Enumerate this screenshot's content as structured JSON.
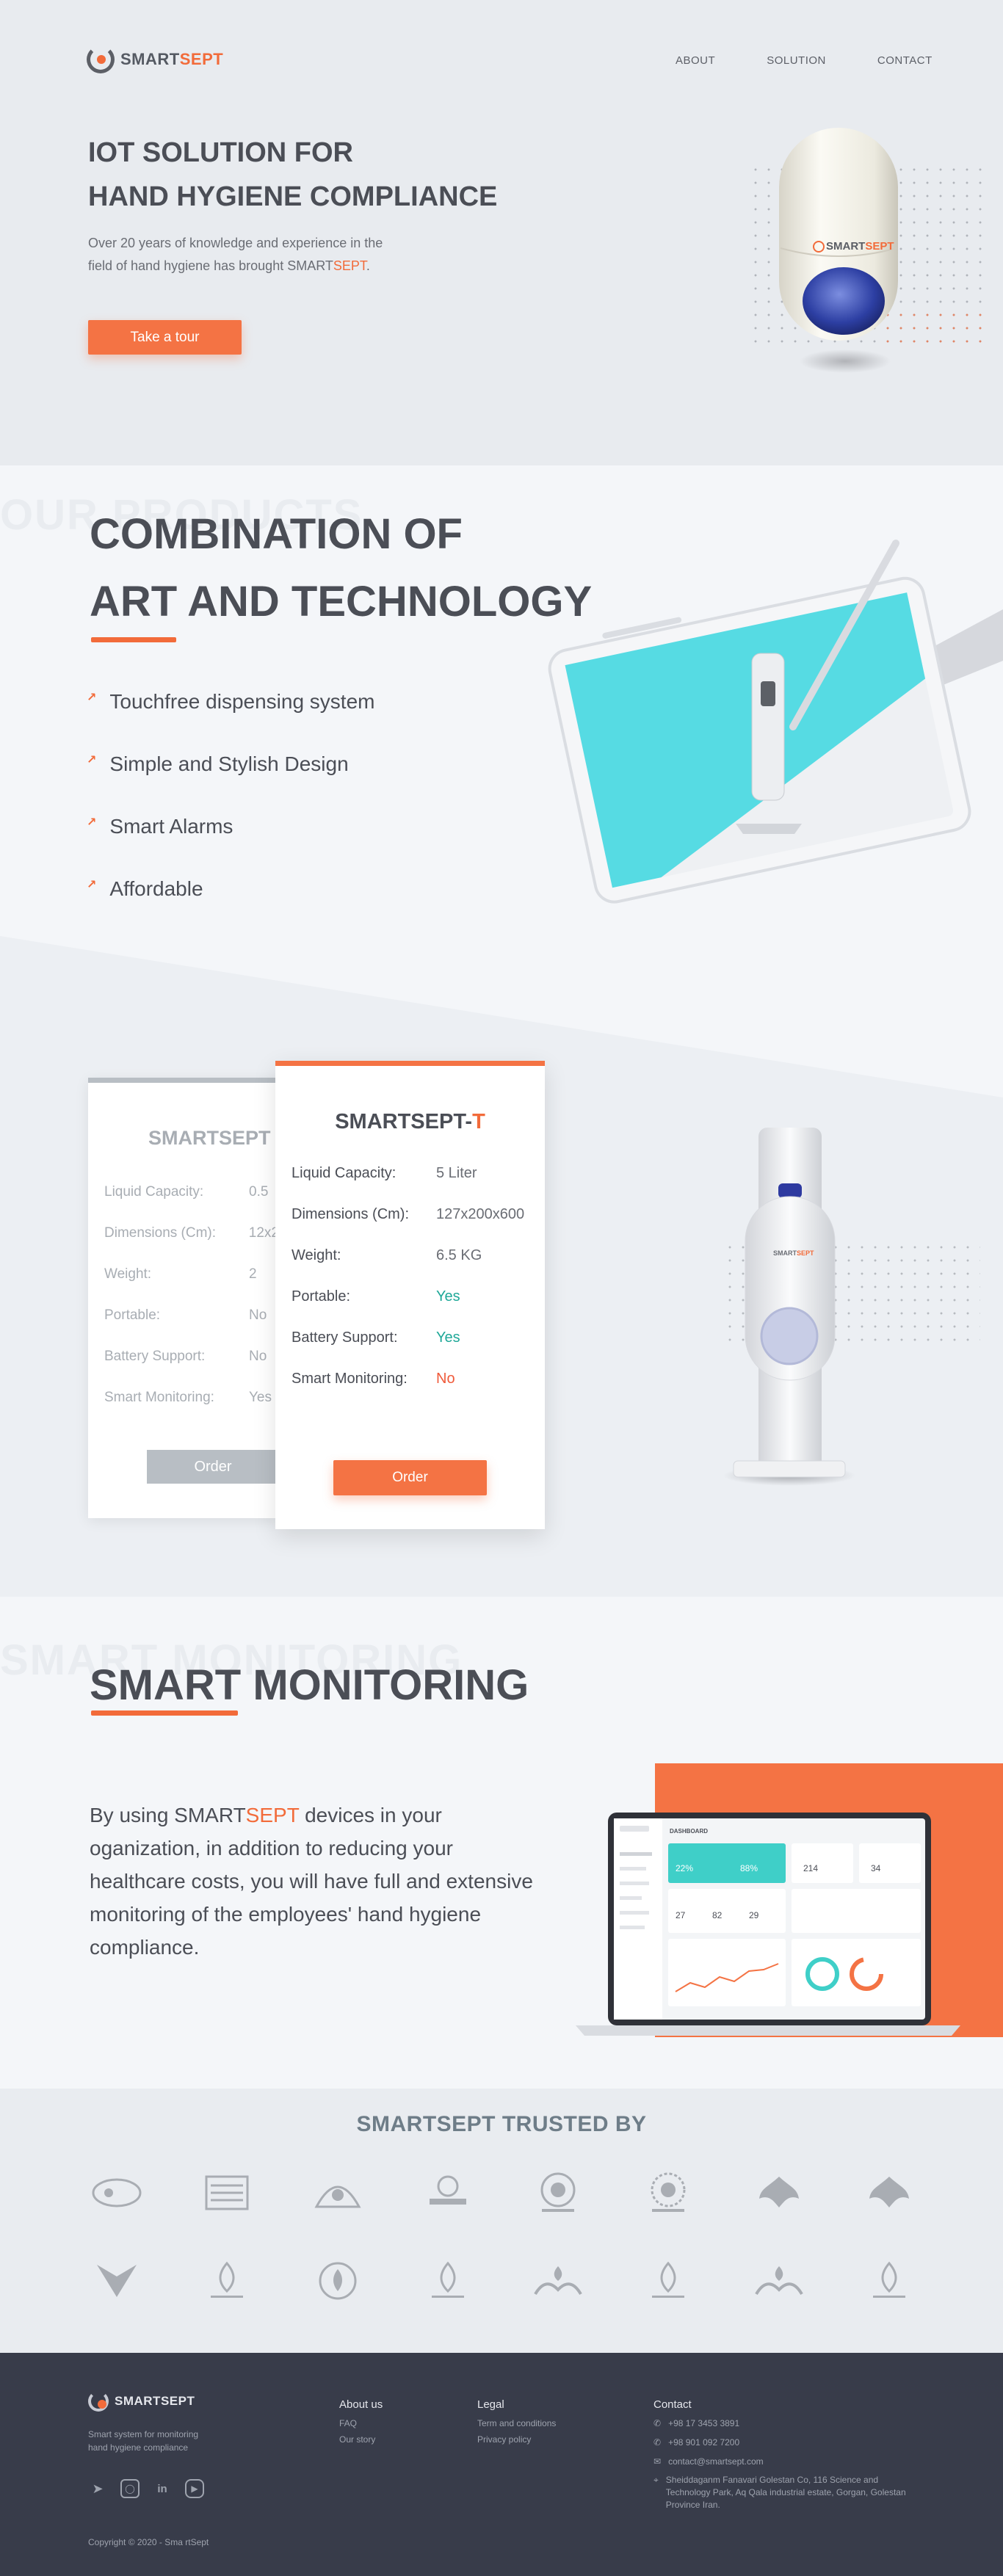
{
  "brand": {
    "name_a": "SMART",
    "name_b": "SEPT",
    "accent": "#f26b3a",
    "dark": "#383c4a"
  },
  "nav": [
    {
      "label": "ABOUT"
    },
    {
      "label": "SOLUTION"
    },
    {
      "label": "CONTACT"
    }
  ],
  "hero": {
    "title_line1": "IOT SOLUTION FOR",
    "title_line2": "HAND HYGIENE COMPLIANCE",
    "desc_line1": "Over 20 years of knowledge and experience in the",
    "desc_line2_a": "field of hand hygiene has brought SMART",
    "desc_line2_b": "SEPT",
    "desc_line2_c": ".",
    "cta": "Take a tour",
    "capsule_brand_a": "SMART",
    "capsule_brand_b": "SEPT"
  },
  "products": {
    "ghost": "OUR PRODUCTS",
    "title_line1": "COMBINATION OF",
    "title_line2": "ART AND TECHNOLOGY",
    "features": [
      {
        "label": "Touchfree dispensing system"
      },
      {
        "label": "Simple and Stylish Design"
      },
      {
        "label": "Smart Alarms"
      },
      {
        "label": "Affordable"
      }
    ]
  },
  "cards": {
    "back": {
      "title": "SMARTSEPT",
      "rows": [
        {
          "k": "Liquid Capacity:",
          "v": "0.5"
        },
        {
          "k": "Dimensions (Cm):",
          "v": "12x2"
        },
        {
          "k": "Weight:",
          "v": "2"
        },
        {
          "k": "Portable:",
          "v": "No"
        },
        {
          "k": "Battery Support:",
          "v": "No"
        },
        {
          "k": "Smart Monitoring:",
          "v": "Yes"
        }
      ],
      "order": "Order"
    },
    "front": {
      "title_a": "SMARTSEPT-",
      "title_b": "T",
      "rows": [
        {
          "k": "Liquid Capacity:",
          "v": "5 Liter"
        },
        {
          "k": "Dimensions (Cm):",
          "v": "127x200x600"
        },
        {
          "k": "Weight:",
          "v": "6.5 KG"
        },
        {
          "k": "Portable:",
          "v": "Yes"
        },
        {
          "k": "Battery Support:",
          "v": "Yes"
        },
        {
          "k": "Smart Monitoring:",
          "v": "No"
        }
      ],
      "order": "Order"
    }
  },
  "monitoring": {
    "ghost": "SMART MONITORING",
    "title": "SMART MONITORING",
    "text_a": "By using SMART",
    "text_b": "SEPT",
    "text_c": " devices in your oganization, in addition to reducing your healthcare costs, you will have full and extensive monitoring of the employees' hand hygiene compliance.",
    "dash_title": "DASHBOARD",
    "dash_stats": [
      "22%",
      "88%",
      "214",
      "34",
      "27",
      "82",
      "29"
    ]
  },
  "trusted": {
    "title": "SMARTSEPT TRUSTED BY",
    "logos_row1": [
      "logo-1",
      "logo-2",
      "logo-3",
      "logo-4",
      "logo-5",
      "logo-6",
      "logo-7",
      "logo-8"
    ],
    "logos_row2": [
      "logo-9",
      "logo-10",
      "logo-11",
      "logo-12",
      "logo-13",
      "logo-14",
      "logo-15",
      "logo-16"
    ]
  },
  "footer": {
    "tagline_line1": "Smart system for  monitoring",
    "tagline_line2": "hand hygiene compliance",
    "about_h": "About us",
    "about_links": [
      {
        "label": "FAQ"
      },
      {
        "label": "Our story"
      }
    ],
    "legal_h": "Legal",
    "legal_links": [
      {
        "label": "Term and conditions"
      },
      {
        "label": "Privacy policy"
      }
    ],
    "contact_h": "Contact",
    "phone1": "+98 17 3453 3891",
    "phone2": "+98 901 092 7200",
    "email": "contact@smartsept.com",
    "address": "Sheiddaganm Fanavari Golestan Co, 116 Science and Technology Park, Aq Qala industrial estate, Gorgan, Golestan Province Iran.",
    "copyright": "Copyright © 2020 - Sma rtSept"
  }
}
